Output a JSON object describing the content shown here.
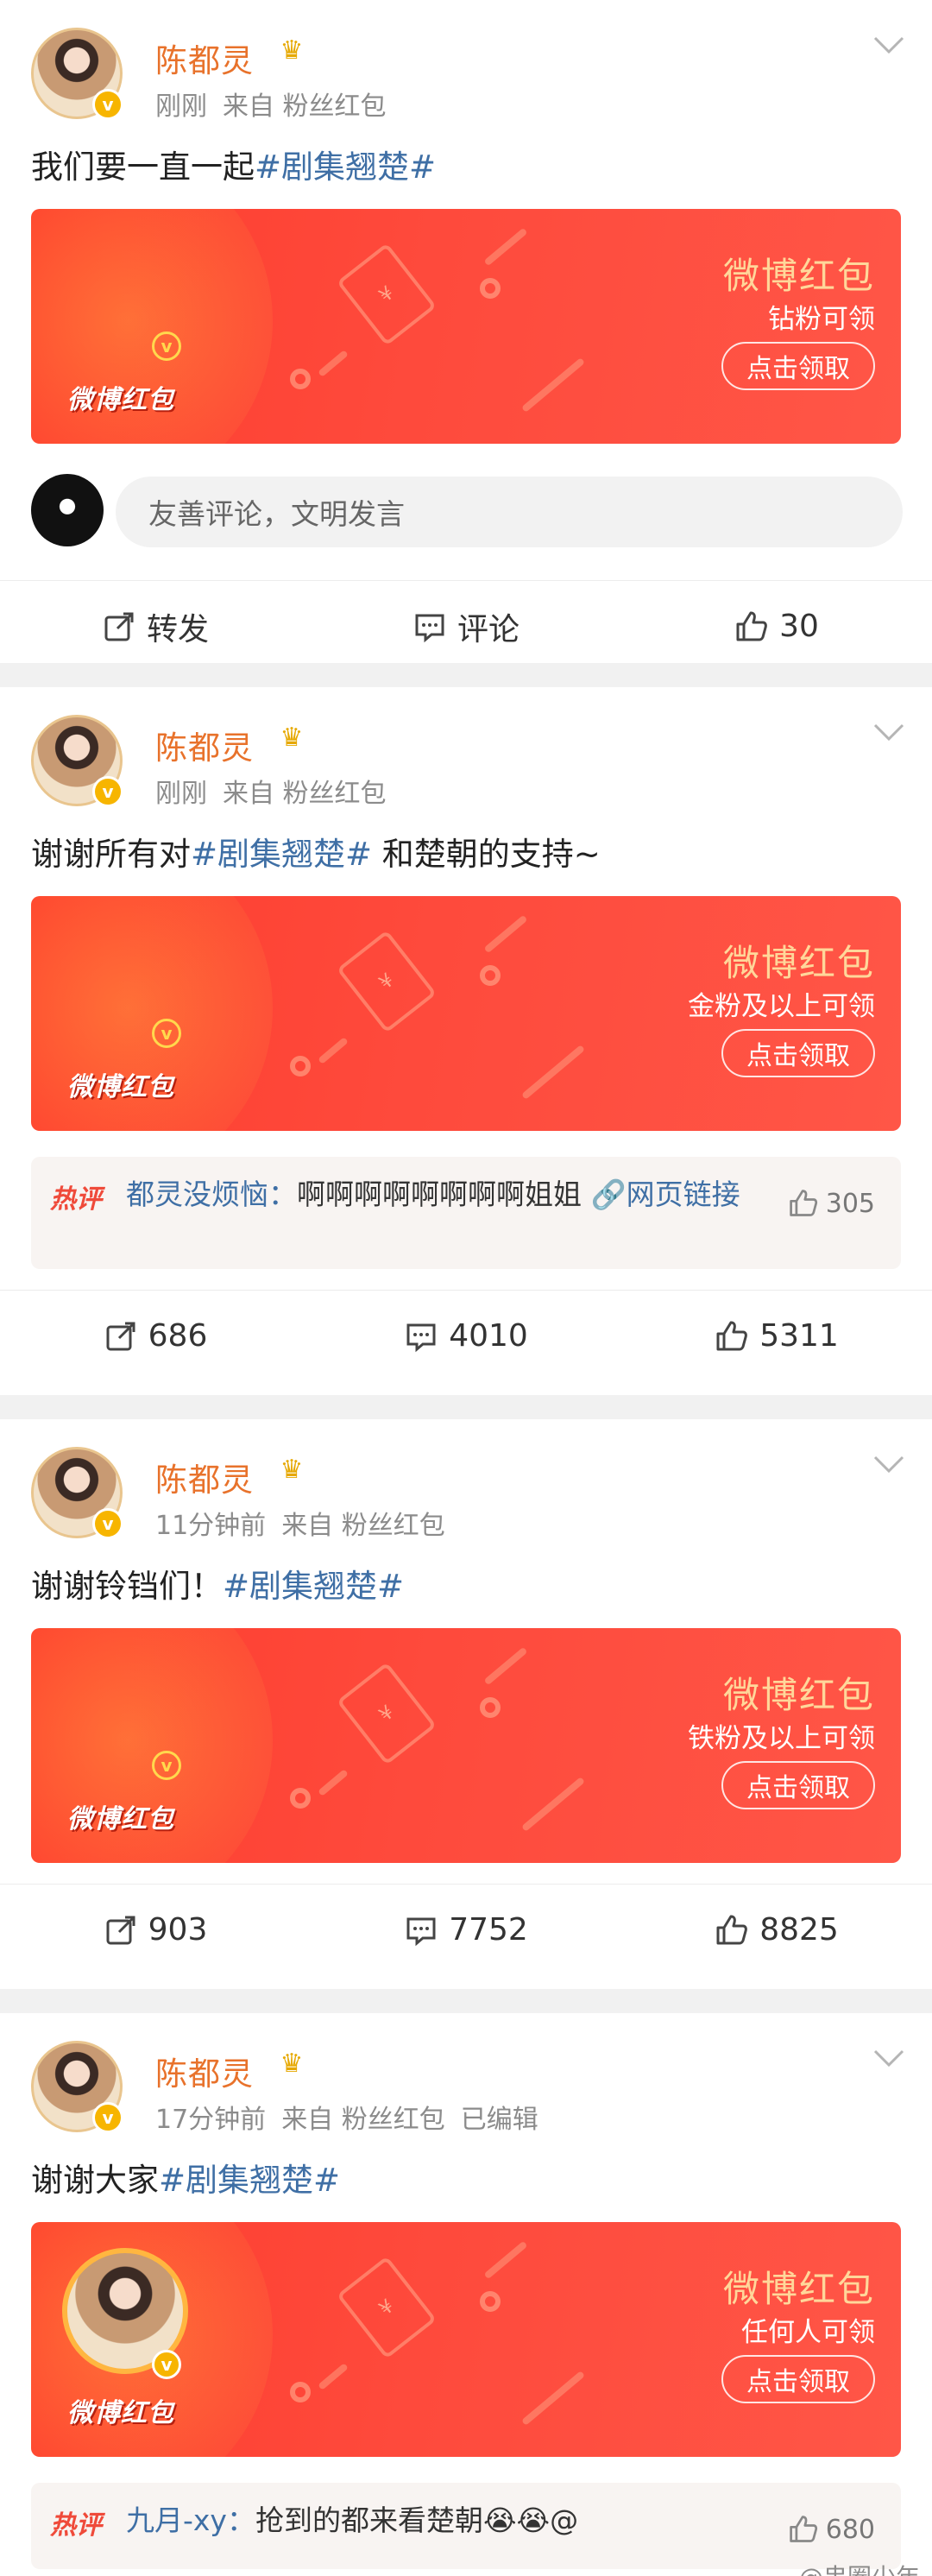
{
  "posts": [
    {
      "username": "陈都灵",
      "time": "刚刚",
      "source": "来自 粉丝红包",
      "edited": "",
      "text_plain": "我们要一直一起",
      "text_tag": "#剧集翘楚#",
      "text_after": "",
      "redpacket": {
        "brand": "微博红包",
        "title": "微博红包",
        "subtitle": "钻粉可领",
        "button": "点击领取"
      },
      "comment_placeholder": "友善评论，文明发言",
      "hot_comment": null,
      "actions": {
        "repost": "转发",
        "comment": "评论",
        "like": "30"
      }
    },
    {
      "username": "陈都灵",
      "time": "刚刚",
      "source": "来自 粉丝红包",
      "edited": "",
      "text_plain": "谢谢所有对",
      "text_tag": "#剧集翘楚#",
      "text_after": " 和楚朝的支持~",
      "redpacket": {
        "brand": "微博红包",
        "title": "微博红包",
        "subtitle": "金粉及以上可领",
        "button": "点击领取"
      },
      "hot_comment": {
        "label": "热评",
        "user": "都灵没烦恼：",
        "text": "啊啊啊啊啊啊啊啊姐姐 ",
        "link": "🔗网页链接",
        "likes": "305"
      },
      "actions": {
        "repost": "686",
        "comment": "4010",
        "like": "5311"
      }
    },
    {
      "username": "陈都灵",
      "time": "11分钟前",
      "source": "来自 粉丝红包",
      "edited": "",
      "text_plain": "谢谢铃铛们！",
      "text_tag": "#剧集翘楚#",
      "text_after": "",
      "redpacket": {
        "brand": "微博红包",
        "title": "微博红包",
        "subtitle": "铁粉及以上可领",
        "button": "点击领取"
      },
      "hot_comment": null,
      "actions": {
        "repost": "903",
        "comment": "7752",
        "like": "8825"
      }
    },
    {
      "username": "陈都灵",
      "time": "17分钟前",
      "source": "来自 粉丝红包",
      "edited": "已编辑",
      "text_plain": "谢谢大家",
      "text_tag": "#剧集翘楚#",
      "text_after": "",
      "redpacket": {
        "brand": "微博红包",
        "title": "微博红包",
        "subtitle": "任何人可领",
        "button": "点击领取"
      },
      "hot_comment": {
        "label": "热评",
        "user": "九月-xy：",
        "text": "抢到的都来看楚朝😭😭@",
        "link": "",
        "likes": "680"
      }
    }
  ],
  "watermark": "@串圈少年",
  "colors": {
    "username": "#e8722b",
    "tag": "#3f6fa5",
    "redpacket": "#fe4a3c",
    "hot_label": "#ef4a3a"
  }
}
